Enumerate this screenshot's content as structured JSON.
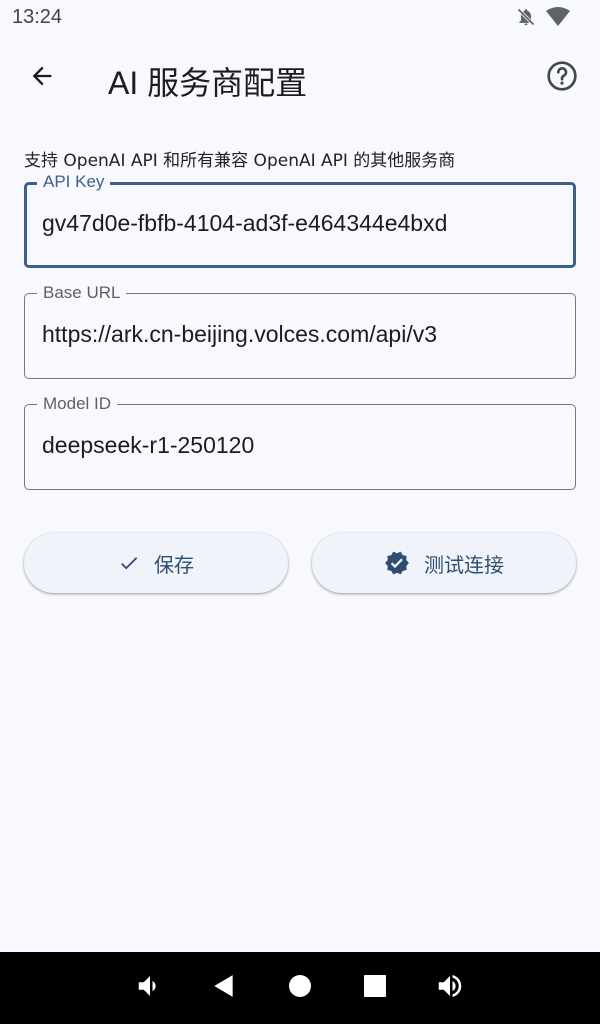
{
  "status_bar": {
    "time": "13:24",
    "icons": [
      "notifications-off-icon",
      "wifi-icon"
    ]
  },
  "app_bar": {
    "back_icon": "arrow-back-icon",
    "title": "AI 服务商配置",
    "help_icon": "help-circle-icon"
  },
  "form": {
    "description": "支持 OpenAI API 和所有兼容 OpenAI API 的其他服务商",
    "fields": [
      {
        "label": "API Key",
        "value": "gv47d0e-fbfb-4104-ad3f-e464344e4bxd",
        "focused": true
      },
      {
        "label": "Base URL",
        "value": "https://ark.cn-beijing.volces.com/api/v3",
        "focused": false
      },
      {
        "label": "Model ID",
        "value": "deepseek-r1-250120",
        "focused": false
      }
    ]
  },
  "actions": {
    "save_label": "保存",
    "save_icon": "check-icon",
    "test_label": "测试连接",
    "test_icon": "verified-icon"
  },
  "colors": {
    "primary": "#3e5f8a",
    "background": "#f8f9ff",
    "button_background": "#f1f3fa",
    "button_text": "#2f4d72"
  },
  "system_nav": {
    "icons": [
      "volume-down-icon",
      "back-triangle-icon",
      "home-circle-icon",
      "recents-square-icon",
      "volume-up-icon"
    ]
  }
}
